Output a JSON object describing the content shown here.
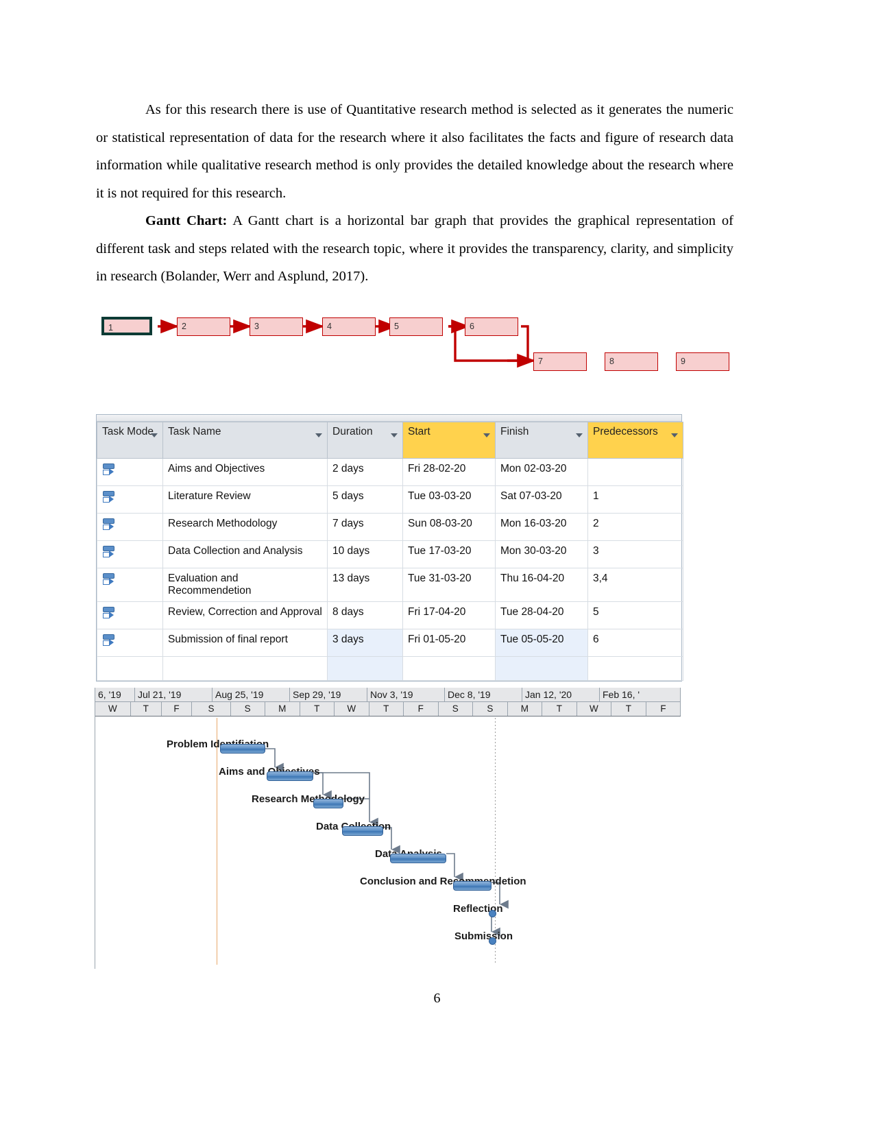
{
  "document": {
    "paragraphs": [
      "As for this research there is use of Quantitative research method is selected as it generates the numeric or statistical representation of data for the  research where it also facilitates the  facts and figure of research data information while qualitative research method is only provides the detailed knowledge about the research where it is not required for this research.",
      "A Gantt chart is a horizontal bar graph that provides the graphical representation of different task and steps related with the research topic, where it provides the transparency, clarity, and simplicity in research (Bolander, Werr and Asplund, 2017)."
    ],
    "gantt_heading": "Gantt Chart:",
    "page_number": "6"
  },
  "network_diagram": {
    "nodes": [
      {
        "id": "1",
        "label": "1",
        "start": true
      },
      {
        "id": "2",
        "label": "2",
        "start": false
      },
      {
        "id": "3",
        "label": "3",
        "start": false
      },
      {
        "id": "4",
        "label": "4",
        "start": false
      },
      {
        "id": "5",
        "label": "5",
        "start": false
      },
      {
        "id": "6",
        "label": "6",
        "start": false
      },
      {
        "id": "7",
        "label": "7",
        "start": false
      },
      {
        "id": "8",
        "label": "8",
        "start": false
      },
      {
        "id": "9",
        "label": "9",
        "start": false
      }
    ],
    "colors": {
      "fill": "#f7cfcf",
      "border": "#c00000",
      "start_border": "#0d3b35"
    }
  },
  "task_table": {
    "columns": [
      {
        "label": "Task Mode",
        "highlight": false
      },
      {
        "label": "Task Name",
        "highlight": false
      },
      {
        "label": "Duration",
        "highlight": false
      },
      {
        "label": "Start",
        "highlight": true
      },
      {
        "label": "Finish",
        "highlight": false
      },
      {
        "label": "Predecessors",
        "highlight": true
      }
    ],
    "rows": [
      {
        "name": "Aims and Objectives",
        "duration": "2 days",
        "start": "Fri 28-02-20",
        "finish": "Mon 02-03-20",
        "predecessors": ""
      },
      {
        "name": "Literature Review",
        "duration": "5 days",
        "start": "Tue 03-03-20",
        "finish": "Sat 07-03-20",
        "predecessors": "1"
      },
      {
        "name": "Research Methodology",
        "duration": "7 days",
        "start": "Sun 08-03-20",
        "finish": "Mon 16-03-20",
        "predecessors": "2"
      },
      {
        "name": "Data Collection and Analysis",
        "duration": "10 days",
        "start": "Tue 17-03-20",
        "finish": "Mon 30-03-20",
        "predecessors": "3"
      },
      {
        "name": "Evaluation and Recommendetion",
        "duration": "13 days",
        "start": "Tue 31-03-20",
        "finish": "Thu 16-04-20",
        "predecessors": "3,4"
      },
      {
        "name": "Review, Correction and Approval",
        "duration": "8 days",
        "start": "Fri 17-04-20",
        "finish": "Tue 28-04-20",
        "predecessors": "5"
      },
      {
        "name": "Submission of final report",
        "duration": "3 days",
        "start": "Fri 01-05-20",
        "finish": "Tue 05-05-20",
        "predecessors": "6"
      }
    ]
  },
  "chart_data": {
    "type": "bar",
    "title": "Gantt Chart",
    "xlabel": "",
    "ylabel": "",
    "timeline_major": [
      "6, '19",
      "Jul 21, '19",
      "Aug 25, '19",
      "Sep 29, '19",
      "Nov 3, '19",
      "Dec 8, '19",
      "Jan 12, '20",
      "Feb 16, '"
    ],
    "timeline_minor": [
      "W",
      "T",
      "F",
      "S",
      "S",
      "M",
      "T",
      "W",
      "T",
      "F",
      "S",
      "S",
      "M",
      "T",
      "W",
      "T",
      "F"
    ],
    "categories": [
      "Problem Identifiation",
      "Aims and Objectives",
      "Research Methodology",
      "Data Collection",
      "Data Analysis",
      "Conclusion and Recommendetion",
      "Reflection",
      "Submission"
    ],
    "bars": [
      {
        "label": "Problem Identifiation",
        "left_pct": 21.5,
        "width_pct": 7.4,
        "row": 0,
        "milestone": false
      },
      {
        "label": "Aims and Objectives",
        "left_pct": 31.5,
        "width_pct": 8.0,
        "row": 1,
        "milestone": false
      },
      {
        "label": "Research Methodology",
        "left_pct": 37.2,
        "width_pct": 5.2,
        "row": 2,
        "milestone": false
      },
      {
        "label": "Data Collection",
        "left_pct": 42.1,
        "width_pct": 6.8,
        "row": 3,
        "milestone": false
      },
      {
        "label": "Data Analysis",
        "left_pct": 50.4,
        "width_pct": 9.5,
        "row": 4,
        "milestone": false
      },
      {
        "label": "Conclusion and Recommendetion",
        "left_pct": 60.0,
        "width_pct": 6.3,
        "row": 5,
        "milestone": false
      },
      {
        "label": "Reflection",
        "left_pct": 66.2,
        "width_pct": 0,
        "row": 6,
        "milestone": true
      },
      {
        "label": "Submission",
        "left_pct": 66.2,
        "width_pct": 0,
        "row": 7,
        "milestone": true
      }
    ],
    "legend": [],
    "grid": true
  }
}
